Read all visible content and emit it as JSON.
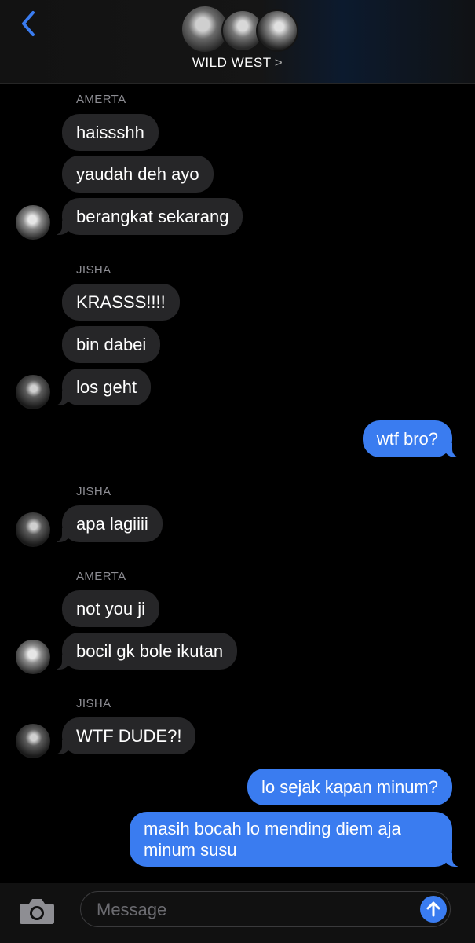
{
  "header": {
    "group_name": "WILD WEST",
    "chevron": ">",
    "back_icon": "chevron-left-icon",
    "accent": "#3a7cf0"
  },
  "messages": [
    {
      "sender": "AMERTA"
    },
    {
      "text": "haissshh"
    },
    {
      "text": "yaudah deh ayo"
    },
    {
      "text": "berangkat sekarang"
    },
    {
      "sender": "JISHA"
    },
    {
      "text": "KRASSS!!!!"
    },
    {
      "text": "bin dabei"
    },
    {
      "text": "los geht"
    },
    {
      "text": "wtf bro?"
    },
    {
      "sender": "JISHA"
    },
    {
      "text": "apa lagiiii"
    },
    {
      "sender": "AMERTA"
    },
    {
      "text": "not you ji"
    },
    {
      "text": "bocil gk bole ikutan"
    },
    {
      "sender": "JISHA"
    },
    {
      "text": "WTF DUDE?!"
    },
    {
      "text": "lo sejak kapan minum?"
    },
    {
      "text_lines": [
        "masih bocah lo mending diem aja",
        "minum susu"
      ]
    }
  ],
  "composer": {
    "placeholder": "Message",
    "camera_icon": "camera-icon",
    "send_icon": "send-arrow-icon"
  },
  "colors": {
    "incoming_bubble": "#262628",
    "outgoing_bubble": "#3a7cf0",
    "sender_label": "#8d8d93"
  }
}
